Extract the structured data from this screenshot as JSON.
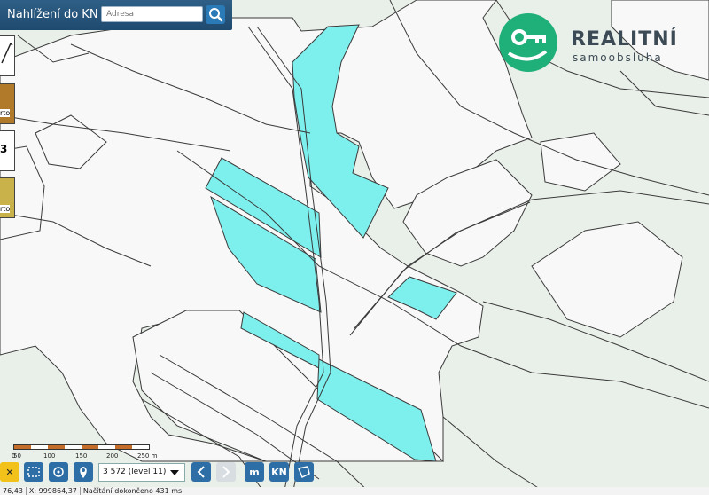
{
  "app": {
    "title": "Nahlížení do KN"
  },
  "search": {
    "placeholder": "Adresa",
    "icon": "search-icon"
  },
  "brand": {
    "line1": "REALITNÍ",
    "line2": "samoobsluha",
    "color": "#1fb07a"
  },
  "map": {
    "land_color": "#f8f8f8",
    "forest_color": "#e9efe9",
    "parcel_highlight": "#7df0ee"
  },
  "scale": {
    "ticks": [
      "0",
      "50",
      "100",
      "150",
      "200",
      "250 m"
    ]
  },
  "toolbar": {
    "level_select": "3 572 (level 11)",
    "kn_label": "KN",
    "m_label": "m",
    "x_label": "✕"
  },
  "left_panel": {
    "sheet_label": "rto"
  },
  "status": {
    "coord_left": "76,43",
    "coord_x": "X: 999864,37",
    "message": "Načítání dokončeno 431 ms"
  }
}
